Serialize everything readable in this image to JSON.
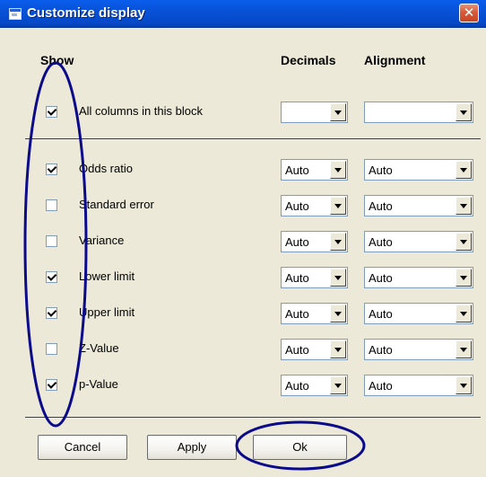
{
  "window": {
    "title": "Customize display",
    "close_label": "✕"
  },
  "headers": {
    "show": "Show",
    "decimals": "Decimals",
    "alignment": "Alignment"
  },
  "block_row": {
    "label": "All columns in this block",
    "checked": true,
    "decimals": "",
    "alignment": ""
  },
  "rows": [
    {
      "label": "Odds ratio",
      "checked": true,
      "decimals": "Auto",
      "alignment": "Auto"
    },
    {
      "label": "Standard error",
      "checked": false,
      "decimals": "Auto",
      "alignment": "Auto"
    },
    {
      "label": "Variance",
      "checked": false,
      "decimals": "Auto",
      "alignment": "Auto"
    },
    {
      "label": "Lower limit",
      "checked": true,
      "decimals": "Auto",
      "alignment": "Auto"
    },
    {
      "label": "Upper limit",
      "checked": true,
      "decimals": "Auto",
      "alignment": "Auto"
    },
    {
      "label": "Z-Value",
      "checked": false,
      "decimals": "Auto",
      "alignment": "Auto"
    },
    {
      "label": "p-Value",
      "checked": true,
      "decimals": "Auto",
      "alignment": "Auto"
    }
  ],
  "buttons": {
    "cancel": "Cancel",
    "apply": "Apply",
    "ok": "Ok"
  },
  "colors": {
    "title_bar": "#0852D8",
    "dialog_bg": "#ECE9D8",
    "annotation": "#0A0A8A"
  }
}
